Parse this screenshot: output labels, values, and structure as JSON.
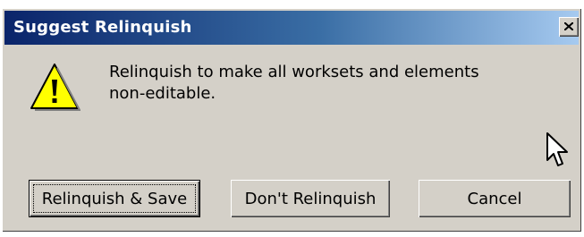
{
  "dialog": {
    "title": "Suggest Relinquish",
    "close_icon": "close-icon",
    "message": "Relinquish to make all worksets and elements\nnon-editable.",
    "icon": "warning-icon",
    "buttons": {
      "save": "Relinquish & Save",
      "dont": "Don't Relinquish",
      "cancel": "Cancel"
    }
  },
  "colors": {
    "title_gradient_start": "#0a246a",
    "title_gradient_end": "#a6caf0",
    "face": "#d4d0c8",
    "warning_yellow": "#ffff00"
  }
}
